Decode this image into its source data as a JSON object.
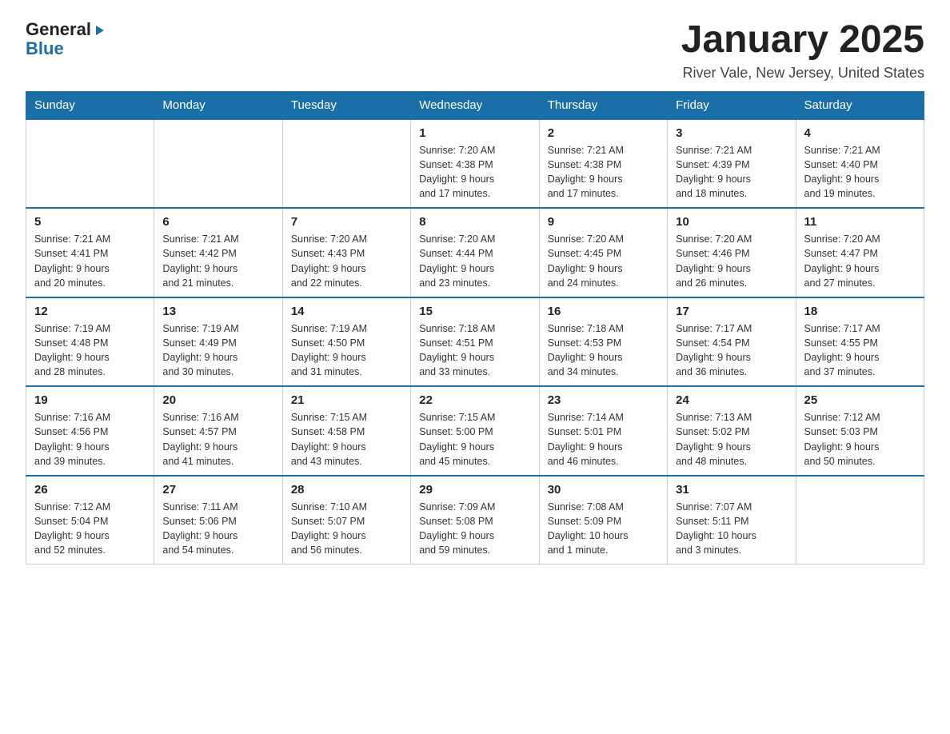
{
  "logo": {
    "general": "General",
    "blue": "Blue"
  },
  "header": {
    "title": "January 2025",
    "subtitle": "River Vale, New Jersey, United States"
  },
  "weekdays": [
    "Sunday",
    "Monday",
    "Tuesday",
    "Wednesday",
    "Thursday",
    "Friday",
    "Saturday"
  ],
  "weeks": [
    [
      {
        "day": "",
        "info": ""
      },
      {
        "day": "",
        "info": ""
      },
      {
        "day": "",
        "info": ""
      },
      {
        "day": "1",
        "info": "Sunrise: 7:20 AM\nSunset: 4:38 PM\nDaylight: 9 hours\nand 17 minutes."
      },
      {
        "day": "2",
        "info": "Sunrise: 7:21 AM\nSunset: 4:38 PM\nDaylight: 9 hours\nand 17 minutes."
      },
      {
        "day": "3",
        "info": "Sunrise: 7:21 AM\nSunset: 4:39 PM\nDaylight: 9 hours\nand 18 minutes."
      },
      {
        "day": "4",
        "info": "Sunrise: 7:21 AM\nSunset: 4:40 PM\nDaylight: 9 hours\nand 19 minutes."
      }
    ],
    [
      {
        "day": "5",
        "info": "Sunrise: 7:21 AM\nSunset: 4:41 PM\nDaylight: 9 hours\nand 20 minutes."
      },
      {
        "day": "6",
        "info": "Sunrise: 7:21 AM\nSunset: 4:42 PM\nDaylight: 9 hours\nand 21 minutes."
      },
      {
        "day": "7",
        "info": "Sunrise: 7:20 AM\nSunset: 4:43 PM\nDaylight: 9 hours\nand 22 minutes."
      },
      {
        "day": "8",
        "info": "Sunrise: 7:20 AM\nSunset: 4:44 PM\nDaylight: 9 hours\nand 23 minutes."
      },
      {
        "day": "9",
        "info": "Sunrise: 7:20 AM\nSunset: 4:45 PM\nDaylight: 9 hours\nand 24 minutes."
      },
      {
        "day": "10",
        "info": "Sunrise: 7:20 AM\nSunset: 4:46 PM\nDaylight: 9 hours\nand 26 minutes."
      },
      {
        "day": "11",
        "info": "Sunrise: 7:20 AM\nSunset: 4:47 PM\nDaylight: 9 hours\nand 27 minutes."
      }
    ],
    [
      {
        "day": "12",
        "info": "Sunrise: 7:19 AM\nSunset: 4:48 PM\nDaylight: 9 hours\nand 28 minutes."
      },
      {
        "day": "13",
        "info": "Sunrise: 7:19 AM\nSunset: 4:49 PM\nDaylight: 9 hours\nand 30 minutes."
      },
      {
        "day": "14",
        "info": "Sunrise: 7:19 AM\nSunset: 4:50 PM\nDaylight: 9 hours\nand 31 minutes."
      },
      {
        "day": "15",
        "info": "Sunrise: 7:18 AM\nSunset: 4:51 PM\nDaylight: 9 hours\nand 33 minutes."
      },
      {
        "day": "16",
        "info": "Sunrise: 7:18 AM\nSunset: 4:53 PM\nDaylight: 9 hours\nand 34 minutes."
      },
      {
        "day": "17",
        "info": "Sunrise: 7:17 AM\nSunset: 4:54 PM\nDaylight: 9 hours\nand 36 minutes."
      },
      {
        "day": "18",
        "info": "Sunrise: 7:17 AM\nSunset: 4:55 PM\nDaylight: 9 hours\nand 37 minutes."
      }
    ],
    [
      {
        "day": "19",
        "info": "Sunrise: 7:16 AM\nSunset: 4:56 PM\nDaylight: 9 hours\nand 39 minutes."
      },
      {
        "day": "20",
        "info": "Sunrise: 7:16 AM\nSunset: 4:57 PM\nDaylight: 9 hours\nand 41 minutes."
      },
      {
        "day": "21",
        "info": "Sunrise: 7:15 AM\nSunset: 4:58 PM\nDaylight: 9 hours\nand 43 minutes."
      },
      {
        "day": "22",
        "info": "Sunrise: 7:15 AM\nSunset: 5:00 PM\nDaylight: 9 hours\nand 45 minutes."
      },
      {
        "day": "23",
        "info": "Sunrise: 7:14 AM\nSunset: 5:01 PM\nDaylight: 9 hours\nand 46 minutes."
      },
      {
        "day": "24",
        "info": "Sunrise: 7:13 AM\nSunset: 5:02 PM\nDaylight: 9 hours\nand 48 minutes."
      },
      {
        "day": "25",
        "info": "Sunrise: 7:12 AM\nSunset: 5:03 PM\nDaylight: 9 hours\nand 50 minutes."
      }
    ],
    [
      {
        "day": "26",
        "info": "Sunrise: 7:12 AM\nSunset: 5:04 PM\nDaylight: 9 hours\nand 52 minutes."
      },
      {
        "day": "27",
        "info": "Sunrise: 7:11 AM\nSunset: 5:06 PM\nDaylight: 9 hours\nand 54 minutes."
      },
      {
        "day": "28",
        "info": "Sunrise: 7:10 AM\nSunset: 5:07 PM\nDaylight: 9 hours\nand 56 minutes."
      },
      {
        "day": "29",
        "info": "Sunrise: 7:09 AM\nSunset: 5:08 PM\nDaylight: 9 hours\nand 59 minutes."
      },
      {
        "day": "30",
        "info": "Sunrise: 7:08 AM\nSunset: 5:09 PM\nDaylight: 10 hours\nand 1 minute."
      },
      {
        "day": "31",
        "info": "Sunrise: 7:07 AM\nSunset: 5:11 PM\nDaylight: 10 hours\nand 3 minutes."
      },
      {
        "day": "",
        "info": ""
      }
    ]
  ]
}
